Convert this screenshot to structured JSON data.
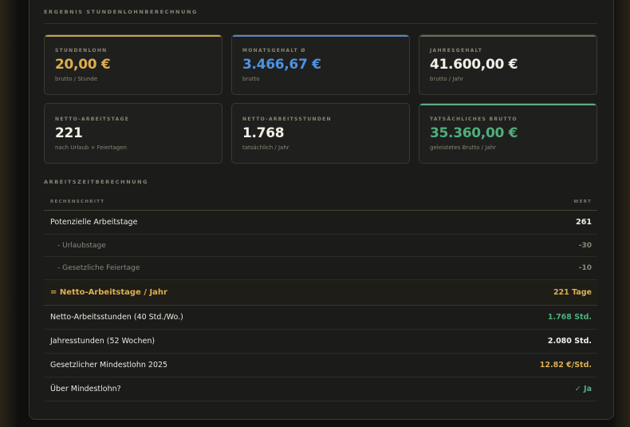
{
  "result_section": {
    "title": "ERGEBNIS STUNDENLOHNBERECHNUNG"
  },
  "colors": {
    "gold": "#dcae4e",
    "blue": "#4d93e0",
    "white": "#f2efe6",
    "green": "#4fae7c"
  },
  "cards": [
    {
      "label": "STUNDENLOHN",
      "value": "20,00 €",
      "sub": "brutto / Stunde",
      "accent": "#c9a24a",
      "value_color": "#dcae4e"
    },
    {
      "label": "MONATSGEHALT Ø",
      "value": "3.466,67 €",
      "sub": "brutto",
      "accent": "#5a86c4",
      "value_color": "#4d93e0"
    },
    {
      "label": "JAHRESGEHALT",
      "value": "41.600,00 €",
      "sub": "brutto / Jahr",
      "accent": "#6e6a5c",
      "value_color": "#f2efe6"
    },
    {
      "label": "NETTO-ARBEITSTAGE",
      "value": "221",
      "sub": "nach Urlaub + Feiertagen",
      "accent": "",
      "value_color": "#f2efe6"
    },
    {
      "label": "NETTO-ARBEITSSTUNDEN",
      "value": "1.768",
      "sub": "tatsächlich / Jahr",
      "accent": "",
      "value_color": "#f2efe6"
    },
    {
      "label": "TATSÄCHLICHES BRUTTO",
      "value": "35.360,00 €",
      "sub": "geleistetes Brutto / Jahr",
      "accent": "#5fae86",
      "value_color": "#4fae7c"
    }
  ],
  "calc_section": {
    "title": "ARBEITSZEITBERECHNUNG",
    "col_step": "RECHENSCHRITT",
    "col_value": "WERT"
  },
  "rows": [
    {
      "label": "Potenzielle Arbeitstage",
      "value": "261",
      "kind": "normal",
      "value_color": "#f2efe6"
    },
    {
      "label": "- Urlaubstage",
      "value": "-30",
      "kind": "sub",
      "value_color": "#8c8878"
    },
    {
      "label": "- Gesetzliche Feiertage",
      "value": "-10",
      "kind": "sub",
      "value_color": "#8c8878"
    },
    {
      "label": "= Netto-Arbeitstage / Jahr",
      "value": "221 Tage",
      "kind": "hl",
      "value_color": "#dcae4e"
    },
    {
      "label": "Netto-Arbeitsstunden (40 Std./Wo.)",
      "value": "1.768 Std.",
      "kind": "normal",
      "value_color": "#4fae7c"
    },
    {
      "label": "Jahresstunden (52 Wochen)",
      "value": "2.080 Std.",
      "kind": "normal",
      "value_color": "#f2efe6"
    },
    {
      "label": "Gesetzlicher Mindestlohn 2025",
      "value": "12.82 €/Std.",
      "kind": "normal",
      "value_color": "#dcae4e"
    },
    {
      "label": "Über Mindestlohn?",
      "value": "✓ Ja",
      "kind": "normal",
      "value_color": "#4fae7c"
    }
  ]
}
